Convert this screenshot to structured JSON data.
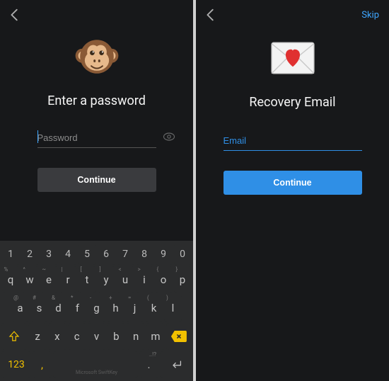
{
  "left": {
    "title": "Enter a password",
    "password_placeholder": "Password",
    "password_value": "",
    "continue_label": "Continue"
  },
  "right": {
    "skip_label": "Skip",
    "title": "Recovery Email",
    "email_placeholder": "Email",
    "email_value": "",
    "continue_label": "Continue"
  },
  "keyboard": {
    "row_nums": [
      "1",
      "2",
      "3",
      "4",
      "5",
      "6",
      "7",
      "8",
      "9",
      "0"
    ],
    "row1": [
      {
        "main": "q",
        "sup": "%"
      },
      {
        "main": "w",
        "sup": "^"
      },
      {
        "main": "e",
        "sup": "~"
      },
      {
        "main": "r",
        "sup": "|"
      },
      {
        "main": "t",
        "sup": "["
      },
      {
        "main": "y",
        "sup": "]"
      },
      {
        "main": "u",
        "sup": "<"
      },
      {
        "main": "i",
        "sup": ">"
      },
      {
        "main": "o",
        "sup": "{"
      },
      {
        "main": "p",
        "sup": "}"
      }
    ],
    "row2": [
      {
        "main": "a",
        "sup": "@"
      },
      {
        "main": "s",
        "sup": "#"
      },
      {
        "main": "d",
        "sup": "&"
      },
      {
        "main": "f",
        "sup": "*"
      },
      {
        "main": "g",
        "sup": "-"
      },
      {
        "main": "h",
        "sup": "+"
      },
      {
        "main": "j",
        "sup": "="
      },
      {
        "main": "k",
        "sup": "("
      },
      {
        "main": "l",
        "sup": ")"
      }
    ],
    "row3": [
      {
        "main": "z",
        "sup": ""
      },
      {
        "main": "x",
        "sup": ""
      },
      {
        "main": "c",
        "sup": ""
      },
      {
        "main": "v",
        "sup": ""
      },
      {
        "main": "b",
        "sup": ""
      },
      {
        "main": "n",
        "sup": ""
      },
      {
        "main": "m",
        "sup": ""
      }
    ],
    "num_toggle": "123",
    "comma": ",",
    "period": ".",
    "brand": "Microsoft SwiftKey"
  }
}
